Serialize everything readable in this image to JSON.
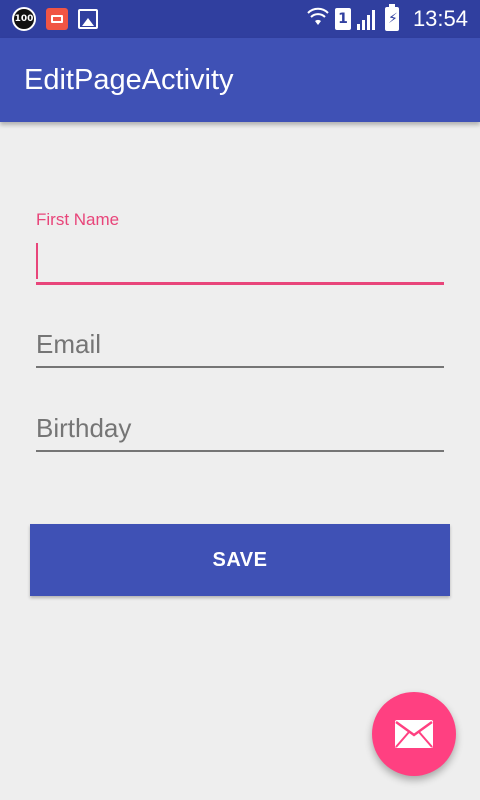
{
  "status_bar": {
    "notif_badge": "100",
    "sim_slot": "1",
    "battery_symbol": "⚡",
    "time": "13:54",
    "icons": [
      "count-100-icon",
      "battery-app-icon",
      "image-icon",
      "wifi-icon",
      "sim-icon",
      "signal-icon",
      "battery-icon"
    ]
  },
  "app_bar": {
    "title": "EditPageActivity"
  },
  "form": {
    "first_name": {
      "label": "First Name",
      "value": ""
    },
    "email": {
      "placeholder": "Email",
      "value": ""
    },
    "birthday": {
      "placeholder": "Birthday",
      "value": ""
    }
  },
  "save_label": "SAVE",
  "fab": {
    "icon": "mail-icon"
  },
  "colors": {
    "primary": "#3f51b5",
    "primary_dark": "#303f9f",
    "accent": "#ff4081",
    "focus": "#e8457a",
    "background": "#eeeeee"
  }
}
